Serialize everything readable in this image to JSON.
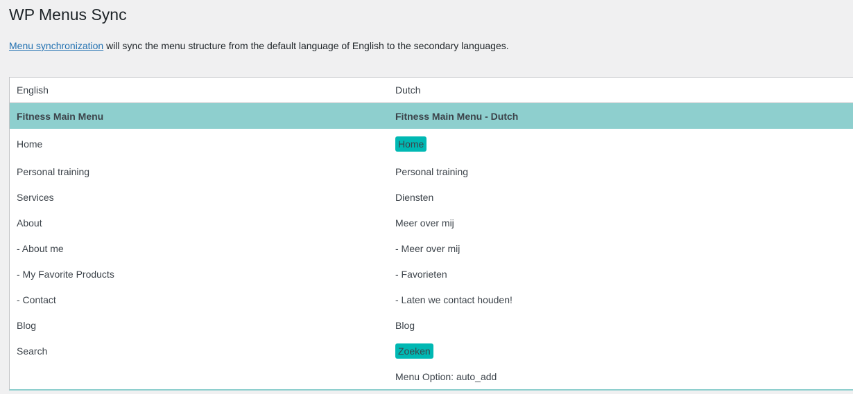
{
  "title": "WP Menus Sync",
  "description": {
    "link": "Menu synchronization",
    "text": " will sync the menu structure from the default language of English to the secondary languages."
  },
  "table": {
    "headers": [
      "English",
      "Dutch"
    ],
    "menu": [
      "Fitness Main Menu",
      "Fitness Main Menu - Dutch"
    ],
    "rows": [
      {
        "en": "Home",
        "nl": "Home",
        "highlight": true
      },
      {
        "en": "Personal training",
        "nl": "Personal training"
      },
      {
        "en": "Services",
        "nl": "Diensten"
      },
      {
        "en": "About",
        "nl": "Meer over mij"
      },
      {
        "en": "- About me",
        "nl": "- Meer over mij"
      },
      {
        "en": "- My Favorite Products",
        "nl": "- Favorieten"
      },
      {
        "en": "- Contact",
        "nl": "- Laten we contact houden!"
      },
      {
        "en": "Blog",
        "nl": "Blog"
      },
      {
        "en": "Search",
        "nl": "Zoeken",
        "highlight": true
      },
      {
        "en": "",
        "nl": "Menu Option: auto_add"
      }
    ]
  },
  "colors": {
    "menu_row": "#8ecfce",
    "highlight": "#00b8b3",
    "link": "#2271b1"
  }
}
